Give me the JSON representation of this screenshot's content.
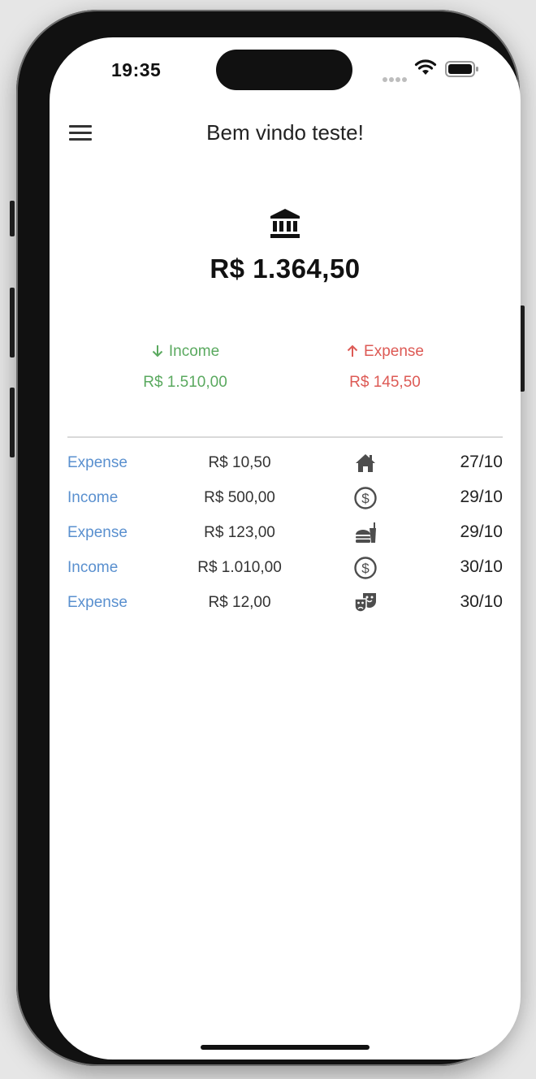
{
  "status_bar": {
    "time": "19:35"
  },
  "header": {
    "title": "Bem vindo teste!"
  },
  "account": {
    "balance": "R$ 1.364,50"
  },
  "summary": {
    "income_label": "Income",
    "income_value": "R$ 1.510,00",
    "expense_label": "Expense",
    "expense_value": "R$ 145,50"
  },
  "transactions": [
    {
      "type": "Expense",
      "amount": "R$ 10,50",
      "icon": "home-icon",
      "date": "27/10"
    },
    {
      "type": "Income",
      "amount": "R$ 500,00",
      "icon": "dollar-icon",
      "date": "29/10"
    },
    {
      "type": "Expense",
      "amount": "R$ 123,00",
      "icon": "fastfood-icon",
      "date": "29/10"
    },
    {
      "type": "Income",
      "amount": "R$ 1.010,00",
      "icon": "dollar-icon",
      "date": "30/10"
    },
    {
      "type": "Expense",
      "amount": "R$ 12,00",
      "icon": "theater-masks-icon",
      "date": "30/10"
    }
  ],
  "colors": {
    "income": "#5aa95f",
    "expense": "#dd5a55",
    "type_text": "#5a90cf"
  }
}
